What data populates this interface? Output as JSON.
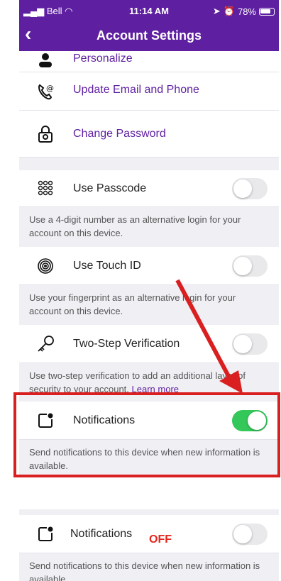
{
  "status_bar": {
    "carrier": "Bell",
    "time": "11:14 AM",
    "battery": "78%"
  },
  "header": {
    "title": "Account Settings"
  },
  "rows": {
    "personalize": "Personalize",
    "update_email": "Update Email and Phone",
    "change_password": "Change Password",
    "passcode": {
      "label": "Use Passcode",
      "desc": "Use a 4-digit number as an alternative login for your account on this device.",
      "on": false
    },
    "touch_id": {
      "label": "Use Touch ID",
      "desc": "Use your fingerprint as an alternative login for your account on this device.",
      "on": false
    },
    "two_step": {
      "label": "Two-Step Verification",
      "desc": "Use two-step verification to add an additional layer of security to your account.",
      "learn_more": "Learn more",
      "on": false
    },
    "notifications": {
      "label": "Notifications",
      "desc": "Send notifications to this device when new information is available.",
      "on": true
    }
  },
  "lower": {
    "notifications": {
      "label": "Notifications",
      "desc": "Send notifications to this device when new information is available.",
      "on": false
    },
    "annotation": "OFF"
  },
  "colors": {
    "brand": "#5e1fa0",
    "toggle_on": "#34c759",
    "annotation_red": "#d91f1f"
  }
}
